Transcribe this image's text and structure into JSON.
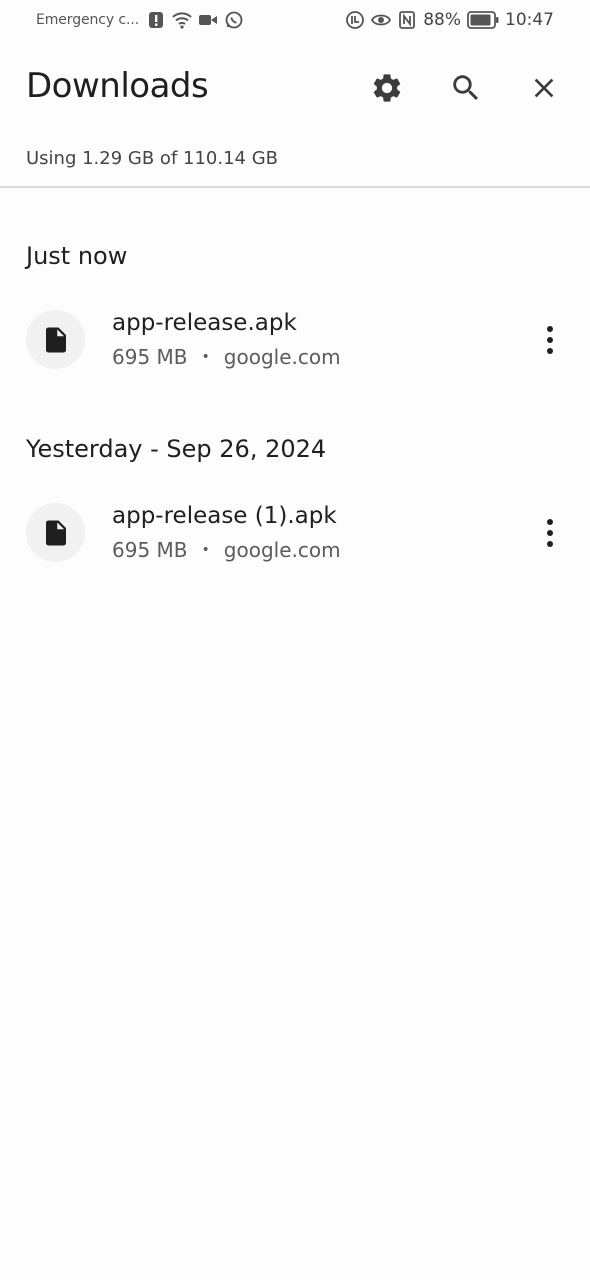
{
  "status_bar": {
    "carrier": "Emergency c...",
    "battery_percent": "88%",
    "time": "10:47",
    "icons_left": [
      "alert-icon",
      "wifi-icon",
      "video-icon",
      "whatsapp-icon"
    ],
    "icons_right": [
      "nfc-speed-icon",
      "eye-icon",
      "nfc-icon",
      "battery-icon"
    ]
  },
  "app_bar": {
    "title": "Downloads",
    "actions": [
      "gear-icon",
      "search-icon",
      "close-icon"
    ]
  },
  "storage": {
    "text": "Using 1.29 GB of 110.14 GB"
  },
  "sections": [
    {
      "header": "Just now",
      "items": [
        {
          "name": "app-release.apk",
          "size": "695 MB",
          "separator": "•",
          "source": "google.com",
          "icon": "file-icon"
        }
      ]
    },
    {
      "header": "Yesterday - Sep 26, 2024",
      "items": [
        {
          "name": "app-release (1).apk",
          "size": "695 MB",
          "separator": "•",
          "source": "google.com",
          "icon": "file-icon"
        }
      ]
    }
  ],
  "colors": {
    "background": "#fdfdfd",
    "text_primary": "#1f1f1f",
    "text_secondary": "#5c5c5c",
    "icon_circle": "#f1f1f1",
    "divider": "#dcdcdc"
  }
}
